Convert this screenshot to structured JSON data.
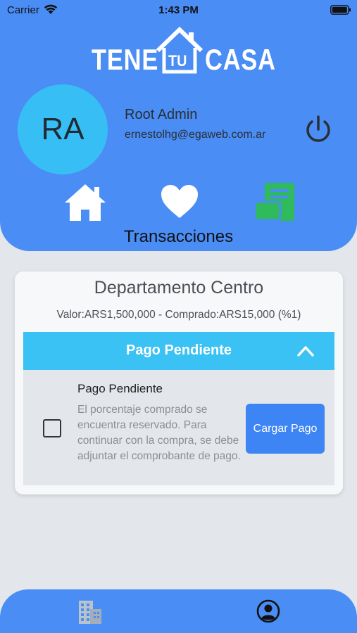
{
  "status_bar": {
    "carrier": "Carrier",
    "time": "1:43 PM"
  },
  "brand": {
    "word_left": "TENE",
    "word_mid": "TU",
    "word_right": "CASA"
  },
  "user": {
    "initials": "RA",
    "name": "Root Admin",
    "email": "ernestolhg@egaweb.com.ar"
  },
  "nav": {
    "icons": [
      "house-icon",
      "heart-icon",
      "money-icon"
    ],
    "section_title": "Transacciones"
  },
  "transaction": {
    "property_name": "Departamento Centro",
    "summary": "Valor:ARS1,500,000 - Comprado:ARS15,000 (%1)",
    "status_header": "Pago Pendiente",
    "item_title": "Pago Pendiente",
    "item_description": "El porcentaje comprado se encuentra reservado. Para continuar con la compra, se debe adjuntar el comprobante de pago.",
    "checkbox_checked": false,
    "action_label": "Cargar Pago"
  },
  "tabbar": {
    "icons": [
      "building-icon",
      "profile-icon"
    ]
  },
  "colors": {
    "primary": "#4a8df5",
    "accent_cyan": "#3ac2f5",
    "avatar_bg": "#37bff5",
    "money_green": "#2fba5b",
    "button_blue": "#3d84f5",
    "background": "#e3e6ea"
  }
}
